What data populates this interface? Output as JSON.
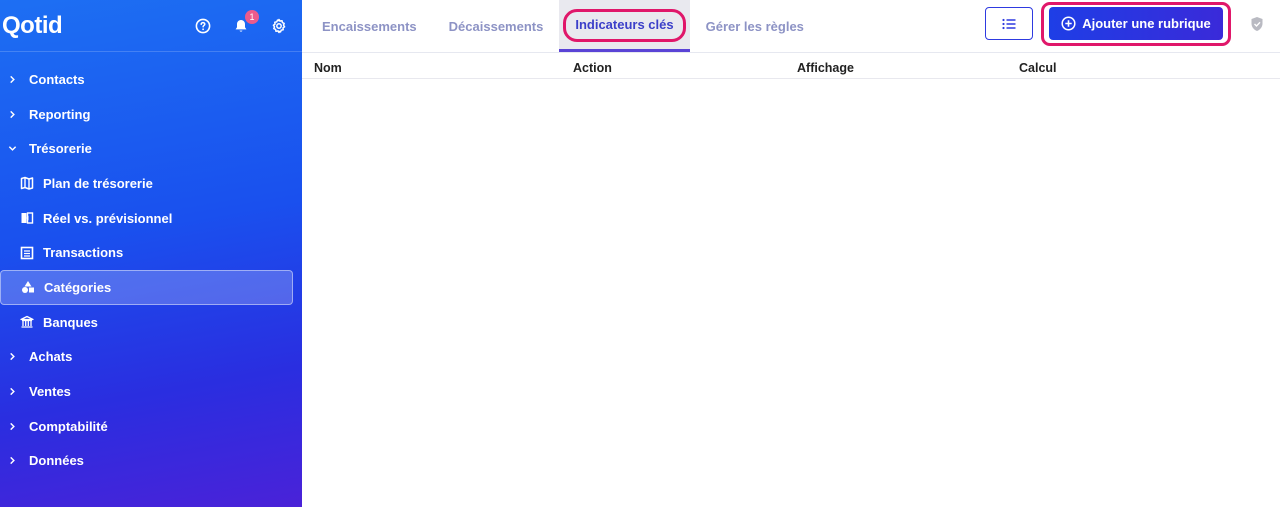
{
  "app": {
    "logo": "Qotid",
    "notifications_count": "1"
  },
  "sidebar": {
    "items": [
      {
        "label": "Contacts",
        "level": "top",
        "expanded": false
      },
      {
        "label": "Reporting",
        "level": "top",
        "expanded": false
      },
      {
        "label": "Trésorerie",
        "level": "top",
        "expanded": true
      },
      {
        "label": "Plan de trésorerie",
        "level": "sub",
        "icon": "map-icon"
      },
      {
        "label": "Réel vs. prévisionnel",
        "level": "sub",
        "icon": "compare-icon"
      },
      {
        "label": "Transactions",
        "level": "sub",
        "icon": "list-icon"
      },
      {
        "label": "Catégories",
        "level": "sub",
        "icon": "shapes-icon",
        "active": true
      },
      {
        "label": "Banques",
        "level": "sub",
        "icon": "bank-icon"
      },
      {
        "label": "Achats",
        "level": "top",
        "expanded": false
      },
      {
        "label": "Ventes",
        "level": "top",
        "expanded": false
      },
      {
        "label": "Comptabilité",
        "level": "top",
        "expanded": false
      },
      {
        "label": "Données",
        "level": "top",
        "expanded": false
      }
    ]
  },
  "tabs": [
    {
      "label": "Encaissements",
      "active": false
    },
    {
      "label": "Décaissements",
      "active": false
    },
    {
      "label": "Indicateurs clés",
      "active": true
    },
    {
      "label": "Gérer les règles",
      "active": false
    }
  ],
  "toolbar": {
    "add_label": "Ajouter une rubrique"
  },
  "table": {
    "columns": [
      "Nom",
      "Action",
      "Affichage",
      "Calcul"
    ],
    "rows": []
  },
  "colors": {
    "accent": "#2e3ae0",
    "highlight": "#e0176a",
    "badge": "#ec5b8c"
  }
}
